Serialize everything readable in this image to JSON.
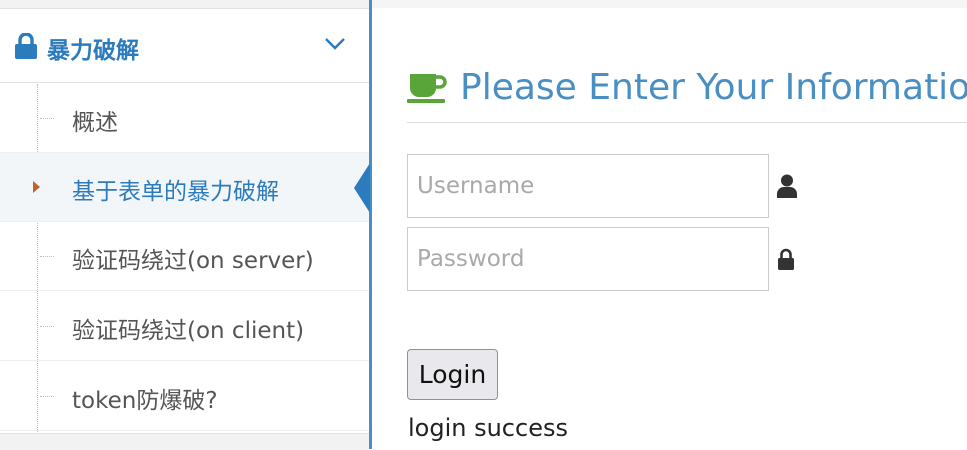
{
  "sidebar": {
    "section_title": "暴力破解",
    "items": [
      {
        "label": "概述"
      },
      {
        "label": "基于表单的暴力破解"
      },
      {
        "label": "验证码绕过(on server)"
      },
      {
        "label": "验证码绕过(on client)"
      },
      {
        "label": "token防爆破?"
      }
    ],
    "active_index": 1
  },
  "main": {
    "title": "Please Enter Your Information",
    "username_placeholder": "Username",
    "username_value": "",
    "password_placeholder": "Password",
    "password_value": "",
    "login_label": "Login",
    "status_message": "login success"
  },
  "icons": {
    "section": "lock-icon",
    "collapse": "chevron-down-icon",
    "title": "coffee-cup-icon",
    "username": "user-icon",
    "password": "lock-icon",
    "active_marker": "caret-right-icon"
  },
  "colors": {
    "accent_blue": "#2c7bbd",
    "title_blue": "#4a8fc4",
    "cup_green": "#5aa53a",
    "caret_orange": "#c0622a"
  }
}
